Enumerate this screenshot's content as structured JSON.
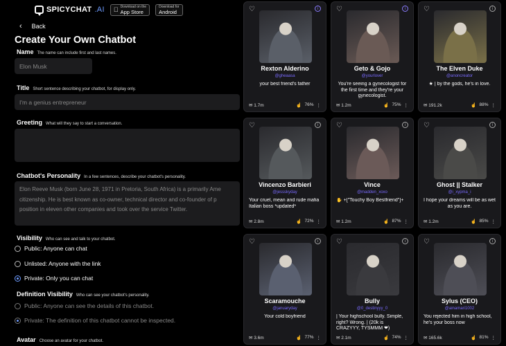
{
  "header": {
    "logo_text": "SPICYCHAT",
    "logo_suffix": ".AI",
    "app_store": {
      "small": "Download on the",
      "big": "App Store"
    },
    "android": {
      "small": "Download for",
      "big": "Android"
    }
  },
  "nav": {
    "back_label": "Back"
  },
  "form": {
    "title": "Create Your Own Chatbot",
    "name": {
      "label": "Name",
      "hint": "The name can include first and last names.",
      "value": "Elon Musk"
    },
    "title_field": {
      "label": "Title",
      "hint": "Short sentence describing your chatbot, for display only.",
      "placeholder": "I'm a genius entrepreneur"
    },
    "greeting": {
      "label": "Greeting",
      "hint": "What will they say to start a conversation.",
      "value": ""
    },
    "personality": {
      "label": "Chatbot's Personality",
      "hint": "In a few sentences, describe your chatbot's personality.",
      "lines": [
        "Elon Reeve Musk (born June 28, 1971 in Pretoria, South Africa) is a primarily Ame",
        "citizenship. He is best known as co-owner, technical director and co-founder of p",
        "position in eleven other companies and took over the service Twitter."
      ]
    },
    "visibility": {
      "label": "Visibility",
      "hint": "Who can see and talk to your chatbot.",
      "options": [
        "Public: Anyone can chat",
        "Unlisted: Anyone with the link",
        "Private: Only you can chat"
      ],
      "selected": 2
    },
    "definition_visibility": {
      "label": "Definition Visibility",
      "hint": "Who can see your chatbot's personality.",
      "options": [
        "Public: Anyone can see the details of this chatbot.",
        "Private: The definition of this chatbot cannot be inspected."
      ],
      "selected": 1
    },
    "avatar": {
      "label": "Avatar",
      "hint": "Choose an avatar for your chatbot."
    }
  },
  "cards": [
    {
      "name": "Rexton Alderino",
      "creator": "@gheaasa",
      "desc": "your best friend's father",
      "views": "1.7m",
      "rating": "76%",
      "art": "#5a5f68"
    },
    {
      "name": "Geto & Gojo",
      "creator": "@yourlover",
      "desc": "You're seeing a gynecologist for the first time and they're your gynecologist.",
      "views": "1.2m",
      "rating": "75%",
      "art": "#6a5a55"
    },
    {
      "name": "The Elven Duke",
      "creator": "@anoncreator",
      "desc": "★ | by the gods, he's in love.",
      "views": "191.2k",
      "rating": "88%",
      "art": "#7a7048"
    },
    {
      "name": "Vincenzo Barbieri",
      "creator": "@jessskyday",
      "desc": "Your cruel, mean and rude mafia Italian boss *updated*",
      "views": "2.8m",
      "rating": "72%",
      "art": "#55595c"
    },
    {
      "name": "Vince",
      "creator": "@madden_xoxo",
      "desc": "✋ +[\"Touchy Boy Bestfriend\"]+",
      "views": "1.2m",
      "rating": "87%",
      "art": "#6b5a58"
    },
    {
      "name": "Ghost || Stalker",
      "creator": "@i_xypma_i",
      "desc": "I hope your dreams will be as wet as you are.",
      "views": "1.2m",
      "rating": "85%",
      "art": "#4a4a48"
    },
    {
      "name": "Scaramouche",
      "creator": "@januaryday",
      "desc": "Your cold boyfriend",
      "views": "3.6m",
      "rating": "77%",
      "art": "#5a6070"
    },
    {
      "name": "Bully",
      "creator": "@0_destinyyy_0",
      "desc": "| Your highschool bully. Simple, right? Wrong. | (20k is CRAZYYY, TYSMMM ❤)",
      "views": "2.1m",
      "rating": "74%",
      "art": "#3a3a3e"
    },
    {
      "name": "Sylus (CEO)",
      "creator": "@ainamari1002",
      "desc": "You rejected him in high school, he's your boss now",
      "views": "165.6k",
      "rating": "81%",
      "art": "#4e4e56"
    }
  ]
}
